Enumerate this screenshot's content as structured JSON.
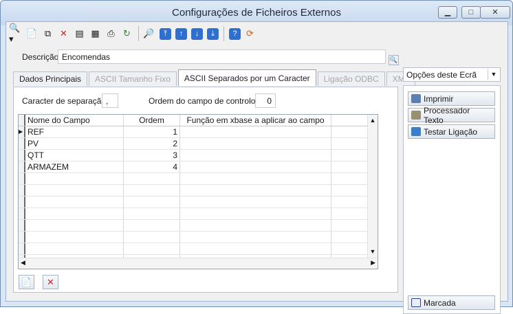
{
  "window": {
    "title": "Configurações de Ficheiros Externos"
  },
  "toolbar": {
    "icons": [
      "search-icon",
      "new-document-icon",
      "copy-icon",
      "delete-icon",
      "properties-icon",
      "table-icon",
      "print-icon",
      "refresh-icon",
      "preview-icon",
      "first-record-icon",
      "previous-record-icon",
      "next-record-icon",
      "last-record-icon",
      "help-icon",
      "exit-icon"
    ]
  },
  "descricao": {
    "label": "Descrição",
    "value": "Encomendas"
  },
  "tabs": [
    {
      "label": "Dados Principais",
      "state": "normal"
    },
    {
      "label": "ASCII Tamanho Fixo",
      "state": "disabled"
    },
    {
      "label": "ASCII Separados por um Caracter",
      "state": "active"
    },
    {
      "label": "Ligação ODBC",
      "state": "disabled"
    },
    {
      "label": "XML",
      "state": "disabled"
    }
  ],
  "form": {
    "separator_label": "Caracter de separação",
    "separator_value": ",",
    "control_order_label": "Ordem do campo de controlo",
    "control_order_value": "0"
  },
  "grid": {
    "columns": [
      "Nome do Campo",
      "Ordem",
      "Função em xbase a aplicar ao campo",
      ""
    ],
    "rows": [
      [
        "REF",
        "1",
        "",
        ""
      ],
      [
        "PV",
        "2",
        "",
        ""
      ],
      [
        "QTT",
        "3",
        "",
        ""
      ],
      [
        "ARMAZEM",
        "4",
        "",
        ""
      ]
    ]
  },
  "options_panel": {
    "title": "Opções deste Ecrã",
    "buttons": [
      "Imprimir",
      "Processador Texto",
      "Testar Ligação"
    ],
    "bottom_button": "Marcada"
  },
  "colors": {
    "accent": "#2f6fd0",
    "delete": "#d62020"
  }
}
